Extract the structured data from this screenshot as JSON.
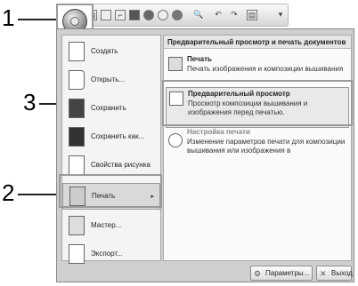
{
  "callouts": [
    "1",
    "2",
    "3"
  ],
  "toolbar": {
    "icons": [
      "new-icon",
      "open-icon",
      "save-icon",
      "circle-icon",
      "circle-icon",
      "stitch-icon",
      "zoom-icon",
      "undo-icon",
      "redo-icon",
      "print-preview-icon"
    ],
    "dropdown_glyph": "▾"
  },
  "menu": {
    "left_items": [
      {
        "label": "Создать",
        "icon": "new-document-icon"
      },
      {
        "label": "Открыть...",
        "icon": "open-folder-icon"
      },
      {
        "label": "Сохранить",
        "icon": "save-icon"
      },
      {
        "label": "Сохранить как...",
        "icon": "save-as-icon"
      },
      {
        "label": "Свойства рисунка",
        "icon": "properties-icon"
      },
      {
        "label": "Печать",
        "icon": "printer-icon",
        "arrow": "▸"
      },
      {
        "label": "Мастер...",
        "icon": "wizard-icon"
      },
      {
        "label": "Экспорт...",
        "icon": "export-icon"
      }
    ],
    "right_header": "Предварительный просмотр и печать документов",
    "right_items": [
      {
        "title": "Печать",
        "desc": "Печать изображения и композиции вышивания",
        "icon": "printer-icon"
      },
      {
        "title": "Предварительный просмотр",
        "desc": "Просмотр композиции вышивания и изображения перед печатью.",
        "icon": "print-preview-icon"
      },
      {
        "title": "Настройка печати",
        "desc": "Изменение параметров печати для композиции вышивания или изображения в",
        "icon": "page-setup-icon"
      }
    ],
    "params_button": "Параметры...",
    "exit_button": "Выход"
  }
}
